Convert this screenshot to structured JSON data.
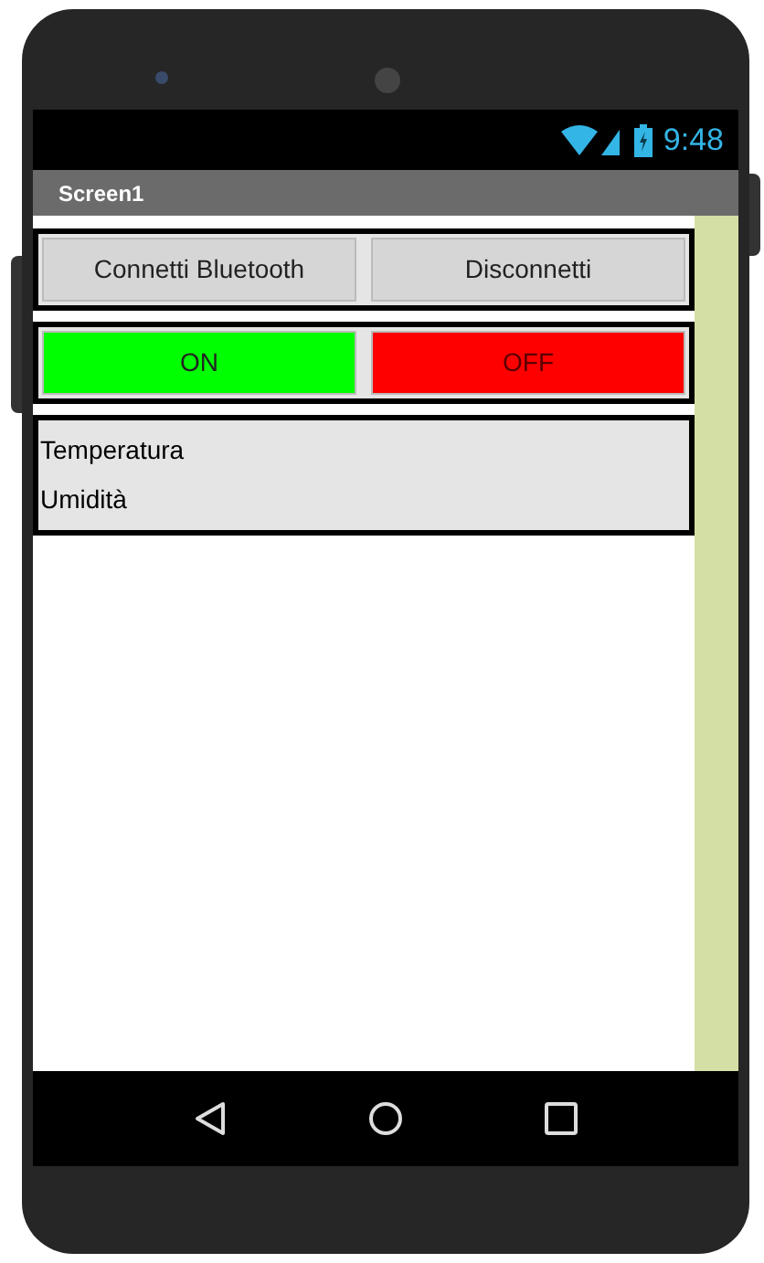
{
  "status_bar": {
    "time": "9:48"
  },
  "title_bar": {
    "title": "Screen1"
  },
  "button_rows": [
    {
      "buttons": [
        {
          "label": "Connetti Bluetooth",
          "color": "#d6d6d6"
        },
        {
          "label": "Disconnetti",
          "color": "#d6d6d6"
        }
      ]
    },
    {
      "buttons": [
        {
          "label": "ON",
          "color": "#00ff00"
        },
        {
          "label": "OFF",
          "color": "#ff0000"
        }
      ]
    }
  ],
  "labels": [
    "Temperatura",
    "Umidità"
  ]
}
